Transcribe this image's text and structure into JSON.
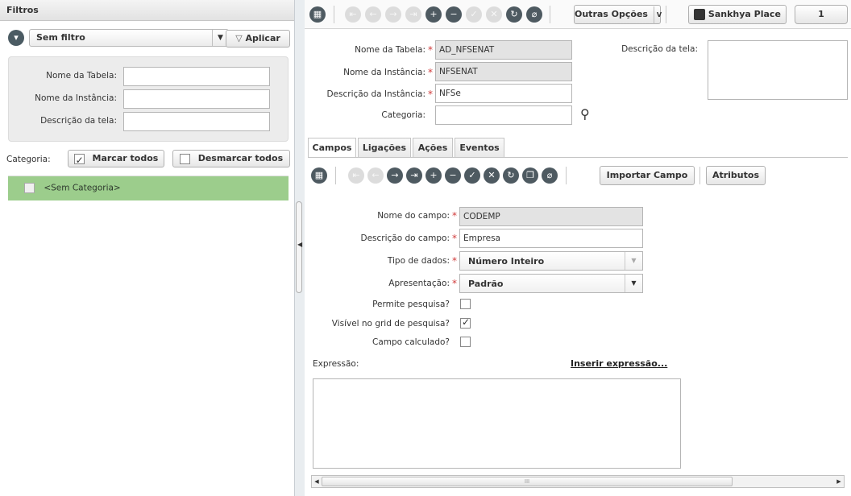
{
  "left": {
    "title": "Filtros",
    "filter_select": "Sem filtro",
    "apply_label": "Aplicar",
    "fields": {
      "nome_tabela_label": "Nome da Tabela:",
      "nome_instancia_label": "Nome da Instância:",
      "descricao_tela_label": "Descrição da tela:"
    },
    "category_label": "Categoria:",
    "mark_all_label": "Marcar todos",
    "unmark_all_label": "Desmarcar todos",
    "category_items": [
      "<Sem Categoria>"
    ]
  },
  "toolbar": {
    "outras_opcoes": "Outras Opções",
    "sankhya_place": "Sankhya Place",
    "page_number": "1",
    "icons": [
      "grid-icon",
      "first-icon",
      "prev-icon",
      "next-icon",
      "last-icon",
      "add-icon",
      "remove-icon",
      "confirm-icon",
      "cancel-icon",
      "refresh-icon",
      "attach-icon"
    ]
  },
  "form": {
    "nome_tabela_label": "Nome da Tabela:",
    "nome_tabela_value": "AD_NFSENAT",
    "nome_instancia_label": "Nome da Instância:",
    "nome_instancia_value": "NFSENAT",
    "descricao_instancia_label": "Descrição da Instância:",
    "descricao_instancia_value": "NFSe",
    "categoria_label": "Categoria:",
    "categoria_value": "",
    "descricao_tela_label": "Descrição da tela:",
    "required_mark": "*"
  },
  "tabs": [
    "Campos",
    "Ligações",
    "Ações",
    "Eventos"
  ],
  "tab_toolbar": {
    "importar_campo": "Importar Campo",
    "atributos": "Atributos"
  },
  "campo": {
    "nome_label": "Nome do campo:",
    "nome_value": "CODEMP",
    "descricao_label": "Descrição do campo:",
    "descricao_value": "Empresa",
    "tipo_label": "Tipo de dados:",
    "tipo_value": "Número Inteiro",
    "apresentacao_label": "Apresentação:",
    "apresentacao_value": "Padrão",
    "permite_pesquisa_label": "Permite pesquisa?",
    "permite_pesquisa": false,
    "visivel_grid_label": "Visível no grid de pesquisa?",
    "visivel_grid": true,
    "campo_calculado_label": "Campo calculado?",
    "campo_calculado": false,
    "expressao_label": "Expressão:",
    "inserir_expressao": "Inserir expressão..."
  },
  "scrollbar": {
    "thumb_label": "III"
  }
}
